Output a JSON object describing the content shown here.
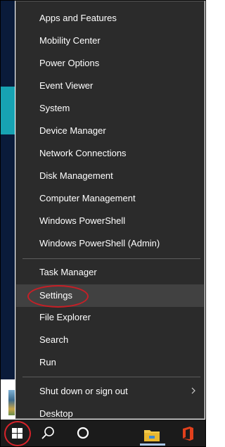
{
  "menu": {
    "items": [
      {
        "label": "Apps and Features"
      },
      {
        "label": "Mobility Center"
      },
      {
        "label": "Power Options"
      },
      {
        "label": "Event Viewer"
      },
      {
        "label": "System"
      },
      {
        "label": "Device Manager"
      },
      {
        "label": "Network Connections"
      },
      {
        "label": "Disk Management"
      },
      {
        "label": "Computer Management"
      },
      {
        "label": "Windows PowerShell"
      },
      {
        "label": "Windows PowerShell (Admin)"
      },
      {
        "label": "Task Manager"
      },
      {
        "label": "Settings"
      },
      {
        "label": "File Explorer"
      },
      {
        "label": "Search"
      },
      {
        "label": "Run"
      },
      {
        "label": "Shut down or sign out"
      },
      {
        "label": "Desktop"
      }
    ],
    "highlighted_item": "Settings"
  },
  "taskbar": {
    "icons": [
      "windows-start-icon",
      "search-icon",
      "cortana-icon",
      "file-explorer-icon",
      "office-icon"
    ]
  },
  "colors": {
    "menu_bg": "#2b2b2b",
    "menu_hover": "#414141",
    "annotation_red": "#d8232a",
    "taskbar_bg": "#1b1b1b"
  }
}
